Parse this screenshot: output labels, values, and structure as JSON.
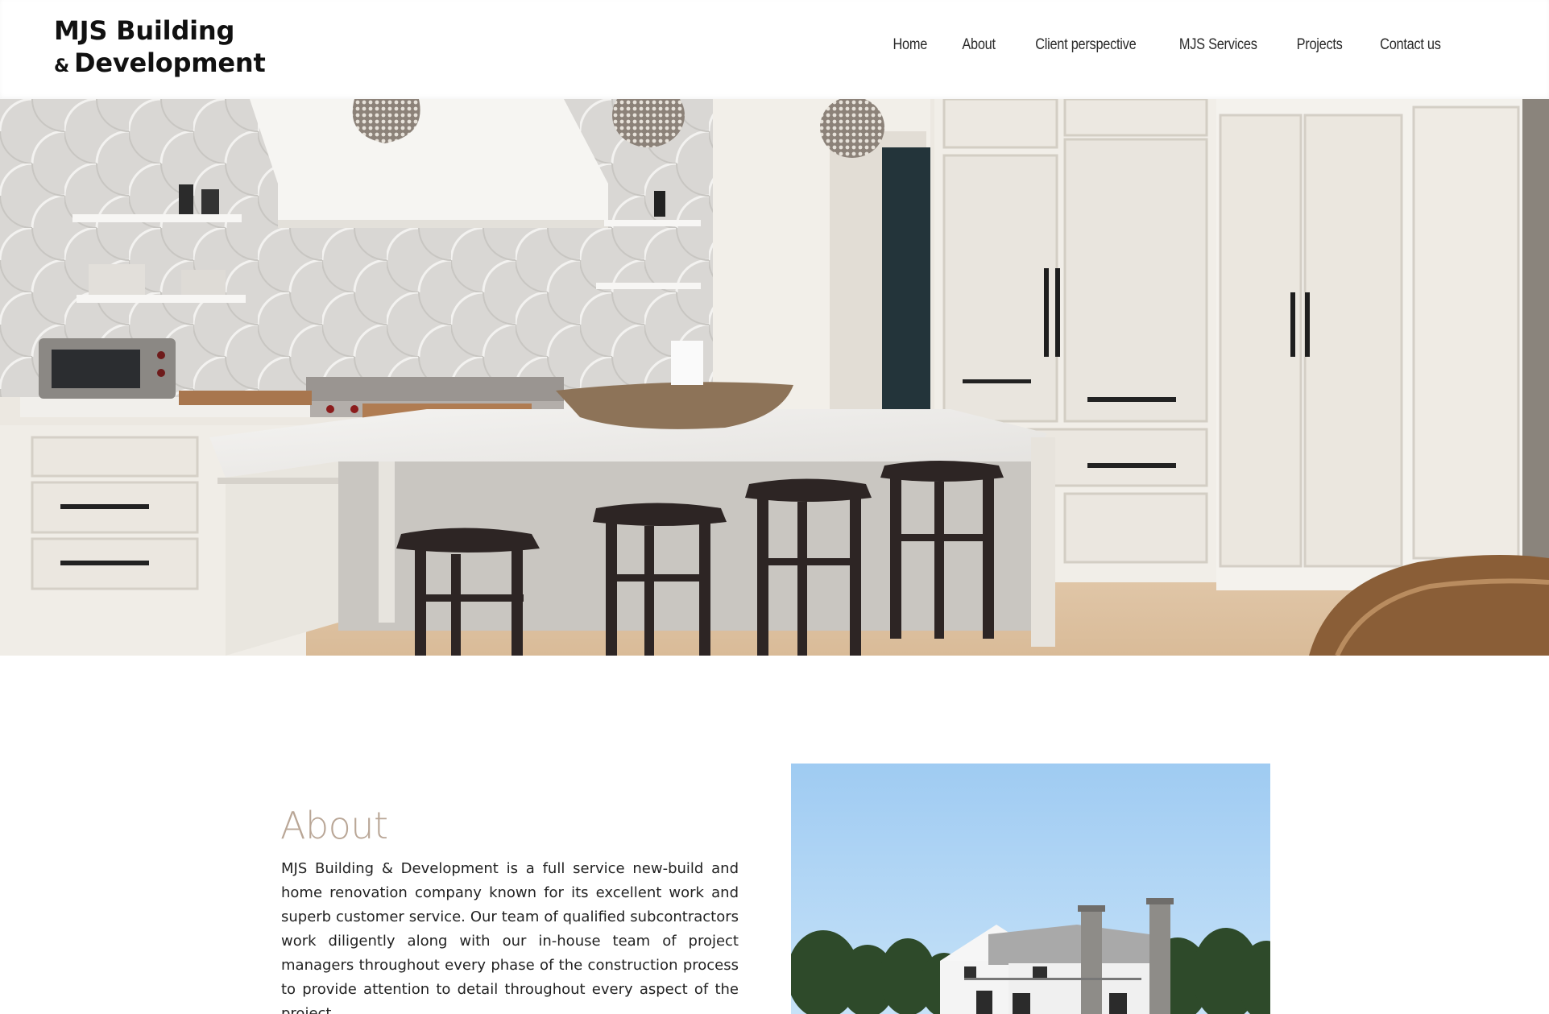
{
  "brand": {
    "line1": "MJS Building",
    "amp": "&",
    "line2": "Development"
  },
  "nav": {
    "items": [
      "Home",
      "About",
      "Client perspective",
      "MJS Services",
      "Projects",
      "Contact us"
    ]
  },
  "hero": {
    "icon": "kitchen-photo"
  },
  "about": {
    "title": "About",
    "body": "MJS Building & Development is a full service new-build and home renovation company known for its excellent work and superb customer service. Our team of qualified subcontractors work diligently along with our in-house team of project managers throughout every phase of the construction process to provide attention to detail throughout every aspect of the project.",
    "photo": "house-photo"
  },
  "colors": {
    "accent": "#b9a696",
    "text": "#222222",
    "sky": "#a9d2f3"
  }
}
